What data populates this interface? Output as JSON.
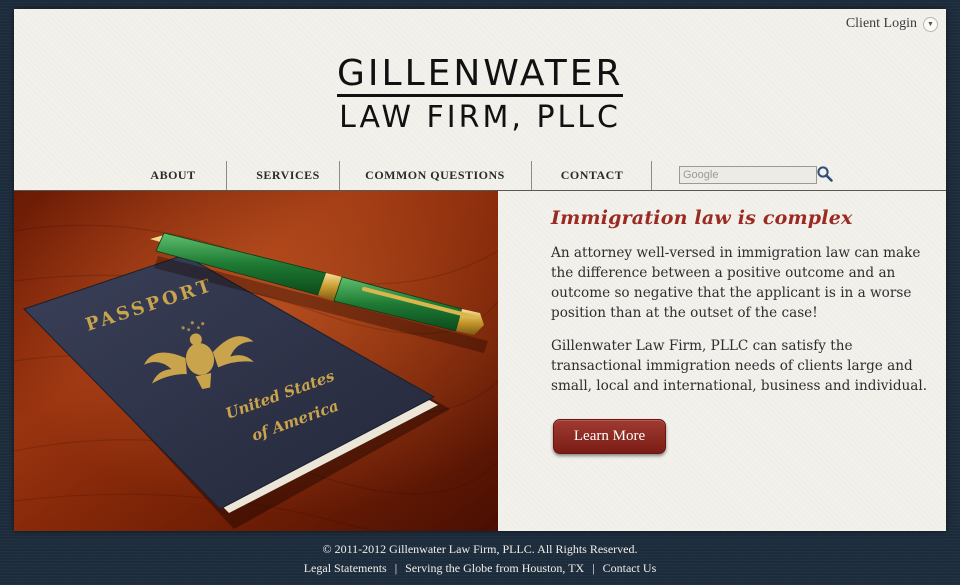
{
  "header": {
    "client_login": "Client Login",
    "logo_line1": "GILLENWATER",
    "logo_line2": "LAW FIRM, PLLC"
  },
  "nav": {
    "items": [
      {
        "label": "ABOUT"
      },
      {
        "label": "SERVICES"
      },
      {
        "label": "COMMON QUESTIONS"
      },
      {
        "label": "CONTACT"
      }
    ],
    "search_placeholder": "Google"
  },
  "hero": {
    "photo_text": {
      "passport": "PASSPORT",
      "country_line1": "United States",
      "country_line2": "of America"
    }
  },
  "main": {
    "heading": "Immigration law is complex",
    "paragraph1": "An attorney well-versed in immigration law can make the difference between a positive outcome and an outcome so negative that the applicant is in a worse position than at the outset of the case!",
    "paragraph2": "Gillenwater Law Firm, PLLC can satisfy the transactional immigration needs of clients large and small, local and international, business and individual.",
    "cta_label": "Learn More"
  },
  "footer": {
    "copyright": "© 2011-2012 Gillenwater Law Firm, PLLC. All Rights Reserved.",
    "links": [
      {
        "label": "Legal Statements"
      },
      {
        "label": "Serving the Globe from Houston, TX"
      },
      {
        "label": "Contact Us"
      }
    ],
    "separator": "|"
  },
  "colors": {
    "accent": "#9c2a22",
    "background": "#1e2d3d",
    "panel": "#f2f1ec",
    "button": "#8a2a22"
  }
}
